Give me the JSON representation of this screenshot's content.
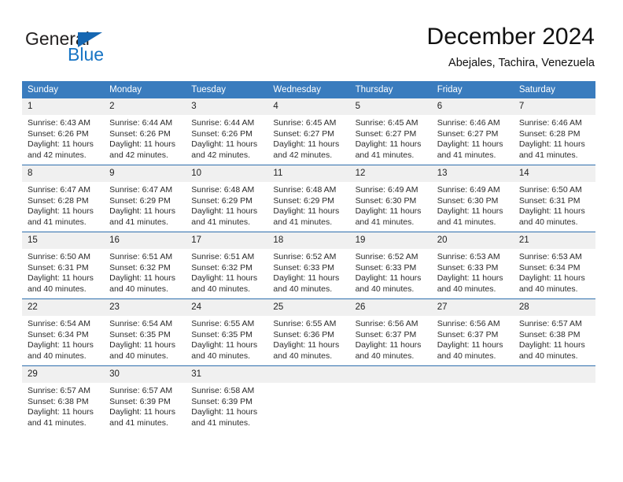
{
  "brand": {
    "name_top": "General",
    "name_bottom": "Blue",
    "accent_color": "#1774c4",
    "triangle_color": "#1667b2"
  },
  "header": {
    "title": "December 2024",
    "subtitle": "Abejales, Tachira, Venezuela"
  },
  "calendar": {
    "header_bg": "#3a7cbe",
    "daynum_bg": "#f0f0f0",
    "rule_color": "#2f6fad",
    "weekdays": [
      "Sunday",
      "Monday",
      "Tuesday",
      "Wednesday",
      "Thursday",
      "Friday",
      "Saturday"
    ],
    "weeks": [
      [
        {
          "day": "1",
          "sunrise": "Sunrise: 6:43 AM",
          "sunset": "Sunset: 6:26 PM",
          "daylight_line1": "Daylight: 11 hours",
          "daylight_line2": "and 42 minutes."
        },
        {
          "day": "2",
          "sunrise": "Sunrise: 6:44 AM",
          "sunset": "Sunset: 6:26 PM",
          "daylight_line1": "Daylight: 11 hours",
          "daylight_line2": "and 42 minutes."
        },
        {
          "day": "3",
          "sunrise": "Sunrise: 6:44 AM",
          "sunset": "Sunset: 6:26 PM",
          "daylight_line1": "Daylight: 11 hours",
          "daylight_line2": "and 42 minutes."
        },
        {
          "day": "4",
          "sunrise": "Sunrise: 6:45 AM",
          "sunset": "Sunset: 6:27 PM",
          "daylight_line1": "Daylight: 11 hours",
          "daylight_line2": "and 42 minutes."
        },
        {
          "day": "5",
          "sunrise": "Sunrise: 6:45 AM",
          "sunset": "Sunset: 6:27 PM",
          "daylight_line1": "Daylight: 11 hours",
          "daylight_line2": "and 41 minutes."
        },
        {
          "day": "6",
          "sunrise": "Sunrise: 6:46 AM",
          "sunset": "Sunset: 6:27 PM",
          "daylight_line1": "Daylight: 11 hours",
          "daylight_line2": "and 41 minutes."
        },
        {
          "day": "7",
          "sunrise": "Sunrise: 6:46 AM",
          "sunset": "Sunset: 6:28 PM",
          "daylight_line1": "Daylight: 11 hours",
          "daylight_line2": "and 41 minutes."
        }
      ],
      [
        {
          "day": "8",
          "sunrise": "Sunrise: 6:47 AM",
          "sunset": "Sunset: 6:28 PM",
          "daylight_line1": "Daylight: 11 hours",
          "daylight_line2": "and 41 minutes."
        },
        {
          "day": "9",
          "sunrise": "Sunrise: 6:47 AM",
          "sunset": "Sunset: 6:29 PM",
          "daylight_line1": "Daylight: 11 hours",
          "daylight_line2": "and 41 minutes."
        },
        {
          "day": "10",
          "sunrise": "Sunrise: 6:48 AM",
          "sunset": "Sunset: 6:29 PM",
          "daylight_line1": "Daylight: 11 hours",
          "daylight_line2": "and 41 minutes."
        },
        {
          "day": "11",
          "sunrise": "Sunrise: 6:48 AM",
          "sunset": "Sunset: 6:29 PM",
          "daylight_line1": "Daylight: 11 hours",
          "daylight_line2": "and 41 minutes."
        },
        {
          "day": "12",
          "sunrise": "Sunrise: 6:49 AM",
          "sunset": "Sunset: 6:30 PM",
          "daylight_line1": "Daylight: 11 hours",
          "daylight_line2": "and 41 minutes."
        },
        {
          "day": "13",
          "sunrise": "Sunrise: 6:49 AM",
          "sunset": "Sunset: 6:30 PM",
          "daylight_line1": "Daylight: 11 hours",
          "daylight_line2": "and 41 minutes."
        },
        {
          "day": "14",
          "sunrise": "Sunrise: 6:50 AM",
          "sunset": "Sunset: 6:31 PM",
          "daylight_line1": "Daylight: 11 hours",
          "daylight_line2": "and 40 minutes."
        }
      ],
      [
        {
          "day": "15",
          "sunrise": "Sunrise: 6:50 AM",
          "sunset": "Sunset: 6:31 PM",
          "daylight_line1": "Daylight: 11 hours",
          "daylight_line2": "and 40 minutes."
        },
        {
          "day": "16",
          "sunrise": "Sunrise: 6:51 AM",
          "sunset": "Sunset: 6:32 PM",
          "daylight_line1": "Daylight: 11 hours",
          "daylight_line2": "and 40 minutes."
        },
        {
          "day": "17",
          "sunrise": "Sunrise: 6:51 AM",
          "sunset": "Sunset: 6:32 PM",
          "daylight_line1": "Daylight: 11 hours",
          "daylight_line2": "and 40 minutes."
        },
        {
          "day": "18",
          "sunrise": "Sunrise: 6:52 AM",
          "sunset": "Sunset: 6:33 PM",
          "daylight_line1": "Daylight: 11 hours",
          "daylight_line2": "and 40 minutes."
        },
        {
          "day": "19",
          "sunrise": "Sunrise: 6:52 AM",
          "sunset": "Sunset: 6:33 PM",
          "daylight_line1": "Daylight: 11 hours",
          "daylight_line2": "and 40 minutes."
        },
        {
          "day": "20",
          "sunrise": "Sunrise: 6:53 AM",
          "sunset": "Sunset: 6:33 PM",
          "daylight_line1": "Daylight: 11 hours",
          "daylight_line2": "and 40 minutes."
        },
        {
          "day": "21",
          "sunrise": "Sunrise: 6:53 AM",
          "sunset": "Sunset: 6:34 PM",
          "daylight_line1": "Daylight: 11 hours",
          "daylight_line2": "and 40 minutes."
        }
      ],
      [
        {
          "day": "22",
          "sunrise": "Sunrise: 6:54 AM",
          "sunset": "Sunset: 6:34 PM",
          "daylight_line1": "Daylight: 11 hours",
          "daylight_line2": "and 40 minutes."
        },
        {
          "day": "23",
          "sunrise": "Sunrise: 6:54 AM",
          "sunset": "Sunset: 6:35 PM",
          "daylight_line1": "Daylight: 11 hours",
          "daylight_line2": "and 40 minutes."
        },
        {
          "day": "24",
          "sunrise": "Sunrise: 6:55 AM",
          "sunset": "Sunset: 6:35 PM",
          "daylight_line1": "Daylight: 11 hours",
          "daylight_line2": "and 40 minutes."
        },
        {
          "day": "25",
          "sunrise": "Sunrise: 6:55 AM",
          "sunset": "Sunset: 6:36 PM",
          "daylight_line1": "Daylight: 11 hours",
          "daylight_line2": "and 40 minutes."
        },
        {
          "day": "26",
          "sunrise": "Sunrise: 6:56 AM",
          "sunset": "Sunset: 6:37 PM",
          "daylight_line1": "Daylight: 11 hours",
          "daylight_line2": "and 40 minutes."
        },
        {
          "day": "27",
          "sunrise": "Sunrise: 6:56 AM",
          "sunset": "Sunset: 6:37 PM",
          "daylight_line1": "Daylight: 11 hours",
          "daylight_line2": "and 40 minutes."
        },
        {
          "day": "28",
          "sunrise": "Sunrise: 6:57 AM",
          "sunset": "Sunset: 6:38 PM",
          "daylight_line1": "Daylight: 11 hours",
          "daylight_line2": "and 40 minutes."
        }
      ],
      [
        {
          "day": "29",
          "sunrise": "Sunrise: 6:57 AM",
          "sunset": "Sunset: 6:38 PM",
          "daylight_line1": "Daylight: 11 hours",
          "daylight_line2": "and 41 minutes."
        },
        {
          "day": "30",
          "sunrise": "Sunrise: 6:57 AM",
          "sunset": "Sunset: 6:39 PM",
          "daylight_line1": "Daylight: 11 hours",
          "daylight_line2": "and 41 minutes."
        },
        {
          "day": "31",
          "sunrise": "Sunrise: 6:58 AM",
          "sunset": "Sunset: 6:39 PM",
          "daylight_line1": "Daylight: 11 hours",
          "daylight_line2": "and 41 minutes."
        },
        {
          "day": "",
          "sunrise": "",
          "sunset": "",
          "daylight_line1": "",
          "daylight_line2": ""
        },
        {
          "day": "",
          "sunrise": "",
          "sunset": "",
          "daylight_line1": "",
          "daylight_line2": ""
        },
        {
          "day": "",
          "sunrise": "",
          "sunset": "",
          "daylight_line1": "",
          "daylight_line2": ""
        },
        {
          "day": "",
          "sunrise": "",
          "sunset": "",
          "daylight_line1": "",
          "daylight_line2": ""
        }
      ]
    ]
  }
}
